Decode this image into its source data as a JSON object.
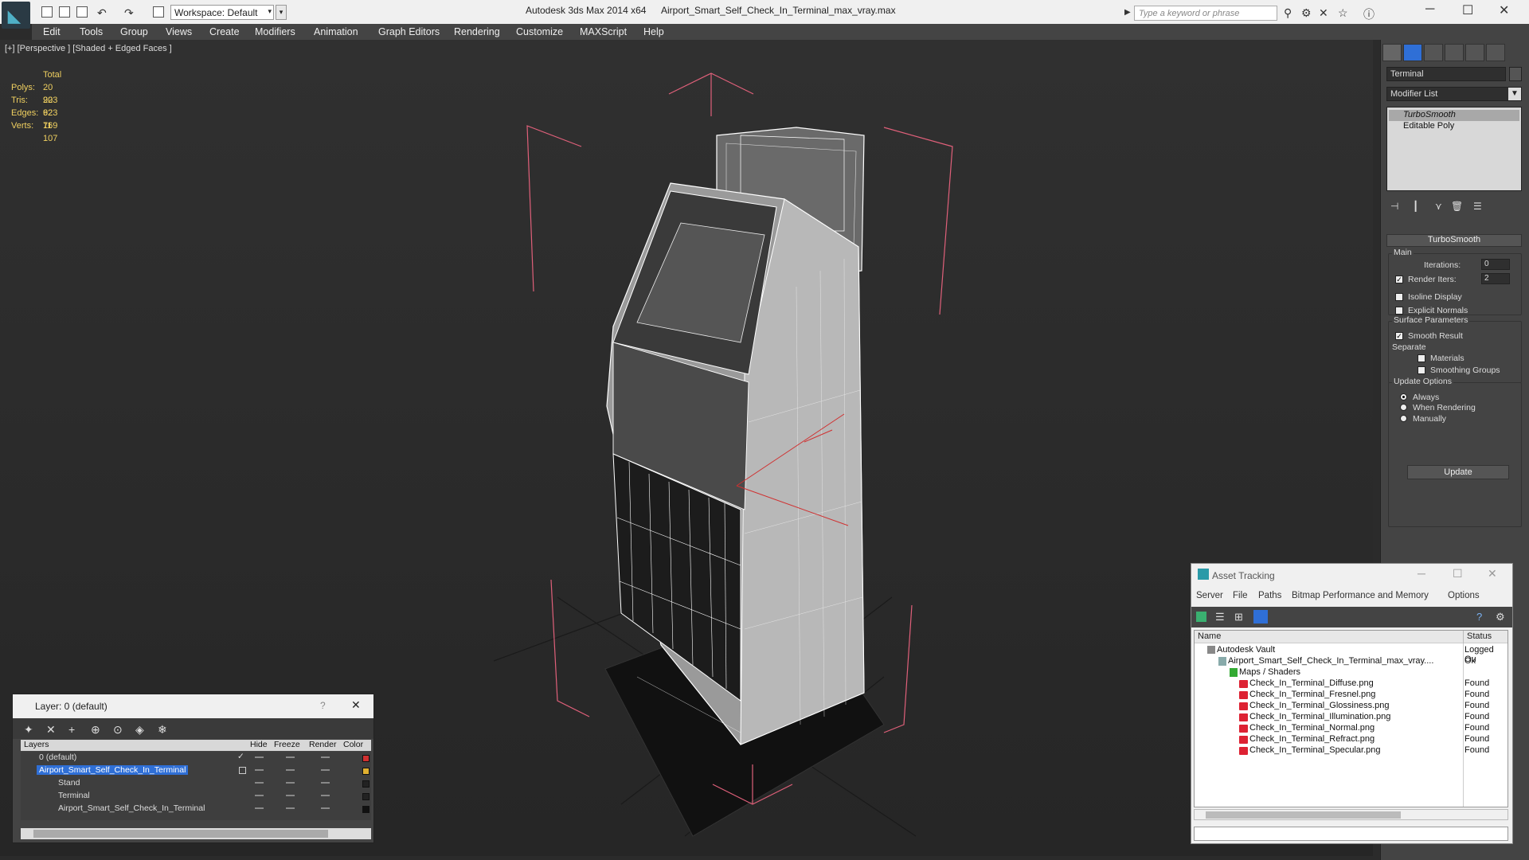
{
  "titlebar": {
    "workspace": "Workspace: Default",
    "app_title": "Autodesk 3ds Max  2014 x64",
    "file_title": "Airport_Smart_Self_Check_In_Terminal_max_vray.max",
    "search_placeholder": "Type a keyword or phrase"
  },
  "menu": [
    "Edit",
    "Tools",
    "Group",
    "Views",
    "Create",
    "Modifiers",
    "Animation",
    "Graph Editors",
    "Rendering",
    "Customize",
    "MAXScript",
    "Help"
  ],
  "viewport": {
    "label": "[+] [Perspective ] [Shaded + Edged Faces ]",
    "stats": {
      "header": "Total",
      "polys_label": "Polys:",
      "polys": "20 923",
      "tris_label": "Tris:",
      "tris": "20 923",
      "edges_label": "Edges:",
      "edges": "62 769",
      "verts_label": "Verts:",
      "verts": "11 107"
    }
  },
  "command_panel": {
    "object_name": "Terminal",
    "modifier_list": "Modifier List",
    "stack": [
      "TurboSmooth",
      "Editable Poly"
    ],
    "rollout": "TurboSmooth",
    "main_label": "Main",
    "iterations_label": "Iterations:",
    "iterations": "0",
    "render_iters_label": "Render Iters:",
    "render_iters": "2",
    "isoline": "Isoline Display",
    "explicit_normals": "Explicit Normals",
    "surface_params": "Surface Parameters",
    "smooth_result": "Smooth Result",
    "separate": "Separate",
    "materials": "Materials",
    "smoothing_groups": "Smoothing Groups",
    "update_options": "Update Options",
    "always": "Always",
    "when_rendering": "When Rendering",
    "manually": "Manually",
    "update_button": "Update"
  },
  "layer_panel": {
    "title": "Layer: 0 (default)",
    "help": "?",
    "columns": [
      "Layers",
      "Hide",
      "Freeze",
      "Render",
      "Color"
    ],
    "rows": [
      {
        "name": "0 (default)",
        "color": "#d03030"
      },
      {
        "name": "Airport_Smart_Self_Check_In_Terminal",
        "color": "#e0b030"
      },
      {
        "name": "Stand",
        "color": "#222222"
      },
      {
        "name": "Terminal",
        "color": "#222222"
      },
      {
        "name": "Airport_Smart_Self_Check_In_Terminal",
        "color": "#111111"
      }
    ]
  },
  "asset_tracking": {
    "title": "Asset Tracking",
    "menu": [
      "Server",
      "File",
      "Paths",
      "Bitmap Performance and Memory",
      "Options"
    ],
    "col_name": "Name",
    "col_status": "Status",
    "rows": [
      {
        "name": "Autodesk Vault",
        "status": "Logged Ou"
      },
      {
        "name": "Airport_Smart_Self_Check_In_Terminal_max_vray....",
        "status": "Ok"
      },
      {
        "name": "Maps / Shaders",
        "status": ""
      },
      {
        "name": "Check_In_Terminal_Diffuse.png",
        "status": "Found"
      },
      {
        "name": "Check_In_Terminal_Fresnel.png",
        "status": "Found"
      },
      {
        "name": "Check_In_Terminal_Glossiness.png",
        "status": "Found"
      },
      {
        "name": "Check_In_Terminal_Illumination.png",
        "status": "Found"
      },
      {
        "name": "Check_In_Terminal_Normal.png",
        "status": "Found"
      },
      {
        "name": "Check_In_Terminal_Refract.png",
        "status": "Found"
      },
      {
        "name": "Check_In_Terminal_Specular.png",
        "status": "Found"
      }
    ]
  },
  "colors": {
    "stats_text": "#f0d060",
    "selection": "#2f6fd6",
    "bbox": "#e0607a"
  }
}
